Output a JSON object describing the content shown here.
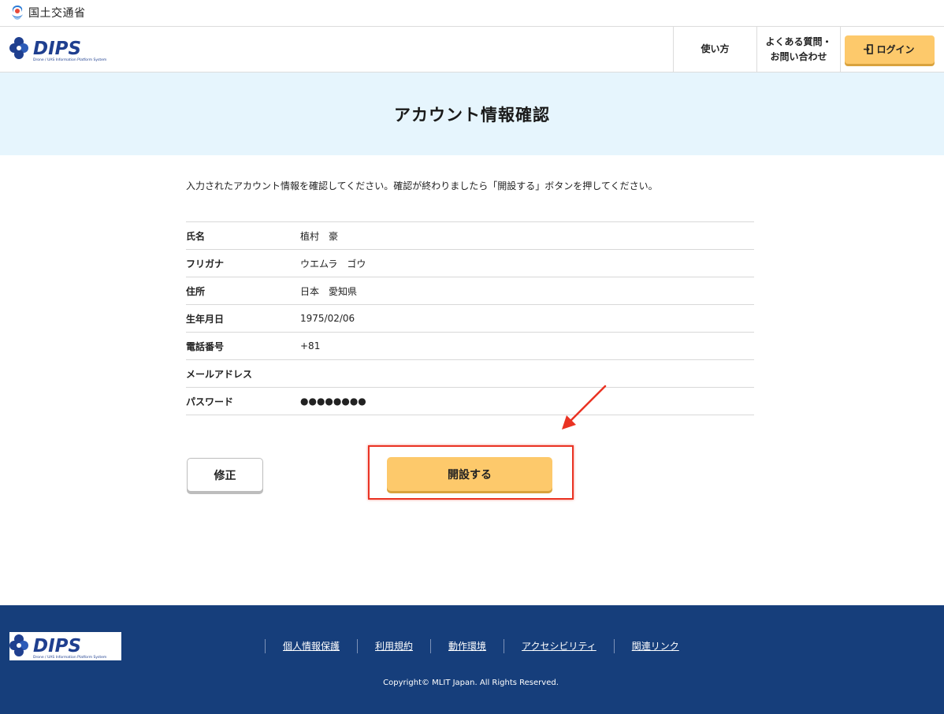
{
  "gov_bar": {
    "ministry_name": "国土交通省"
  },
  "header": {
    "logo_text": "DIPS",
    "logo_subtext": "Drone / UAS Information Platform System",
    "nav": {
      "usage": "使い方",
      "faq_line1": "よくある質問・",
      "faq_line2": "お問い合わせ",
      "login": "ログイン"
    }
  },
  "page": {
    "title": "アカウント情報確認",
    "instruction": "入力されたアカウント情報を確認してください。確認が終わりましたら「開設する」ボタンを押してください。"
  },
  "account_info": {
    "rows": [
      {
        "label": "氏名",
        "value": "植村　豪"
      },
      {
        "label": "フリガナ",
        "value": "ウエムラ　ゴウ"
      },
      {
        "label": "住所",
        "value": "日本　愛知県"
      },
      {
        "label": "生年月日",
        "value": "1975/02/06"
      },
      {
        "label": "電話番号",
        "value": "+81"
      },
      {
        "label": "メールアドレス",
        "value": ""
      },
      {
        "label": "パスワード",
        "value": "●●●●●●●●"
      }
    ]
  },
  "actions": {
    "fix_label": "修正",
    "open_label": "開設する"
  },
  "footer": {
    "links": [
      "個人情報保護",
      "利用規約",
      "動作環境",
      "アクセシビリティ",
      "関連リンク"
    ],
    "copyright": "Copyright© MLIT Japan. All Rights Reserved."
  },
  "colors": {
    "accent_yellow": "#fdc96b",
    "title_band": "#e6f5fd",
    "footer_navy": "#163e7b",
    "logo_blue": "#1f3f8f",
    "annotation_red": "#ea3323"
  }
}
